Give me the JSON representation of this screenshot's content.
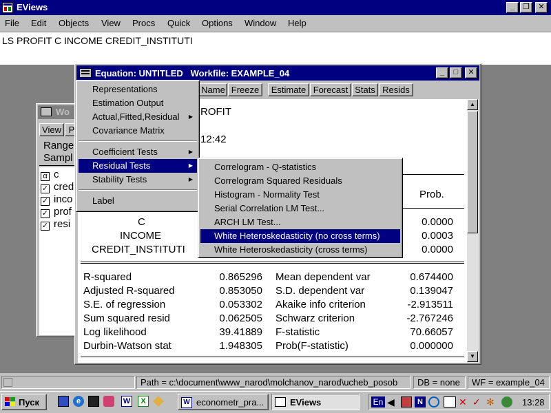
{
  "app": {
    "title": "EViews",
    "menu": [
      "File",
      "Edit",
      "Objects",
      "View",
      "Procs",
      "Quick",
      "Options",
      "Window",
      "Help"
    ],
    "command": "LS PROFIT  C INCOME CREDIT_INSTITUTI"
  },
  "back_window": {
    "title": "Wo",
    "toolbar": [
      "View",
      "P"
    ],
    "lines": [
      "Range",
      "Sampl"
    ],
    "items": [
      {
        "icon": "α",
        "label": "c"
      },
      {
        "icon": "✓",
        "label": "cred"
      },
      {
        "icon": "✓",
        "label": "inco"
      },
      {
        "icon": "✓",
        "label": "prof"
      },
      {
        "icon": "✓",
        "label": "resi"
      }
    ]
  },
  "eq_window": {
    "title": "Equation: UNTITLED   Workfile: EXAMPLE_04",
    "toolbar": [
      "Name",
      "Freeze",
      "Estimate",
      "Forecast",
      "Stats",
      "Resids"
    ],
    "partial_lines": [
      "ROFIT",
      "12:42"
    ],
    "prob_header": "Prob.",
    "coef_rows": [
      {
        "name": "C",
        "prob": "0.0000"
      },
      {
        "name": "INCOME",
        "prob": "0.0003"
      },
      {
        "name": "CREDIT_INSTITUTI",
        "prob": "0.0000"
      }
    ],
    "stats_left": [
      {
        "label": "R-squared",
        "value": "0.865296"
      },
      {
        "label": "Adjusted R-squared",
        "value": "0.853050"
      },
      {
        "label": "S.E. of regression",
        "value": "0.053302"
      },
      {
        "label": "Sum squared resid",
        "value": "0.062505"
      },
      {
        "label": "Log likelihood",
        "value": "39.41889"
      },
      {
        "label": "Durbin-Watson stat",
        "value": "1.948305"
      }
    ],
    "stats_right": [
      {
        "label": "Mean dependent var",
        "value": "0.674400"
      },
      {
        "label": "S.D. dependent var",
        "value": "0.139047"
      },
      {
        "label": "Akaike info criterion",
        "value": "-2.913511"
      },
      {
        "label": "Schwarz criterion",
        "value": "-2.767246"
      },
      {
        "label": "F-statistic",
        "value": "70.66057"
      },
      {
        "label": "Prob(F-statistic)",
        "value": "0.000000"
      }
    ]
  },
  "view_menu": {
    "items": [
      "Representations",
      "Estimation Output",
      "Actual,Fitted,Residual",
      "Covariance Matrix",
      "Coefficient Tests",
      "Residual Tests",
      "Stability Tests",
      "Label"
    ]
  },
  "residual_submenu": {
    "items": [
      "Correlogram - Q-statistics",
      "Correlogram Squared Residuals",
      "Histogram - Normality Test",
      "Serial Correlation LM Test...",
      "ARCH LM Test...",
      "White Heteroskedasticity (no cross terms)",
      "White Heteroskedasticity (cross terms)"
    ]
  },
  "status_bar": {
    "path": "Path = c:\\document\\www_narod\\molchanov_narod\\ucheb_posob",
    "db": "DB = none",
    "wf": "WF = example_04"
  },
  "taskbar": {
    "start": "Пуск",
    "tasks": [
      "econometr_pra...",
      "EViews"
    ],
    "lang": "En",
    "clock": "13:28"
  },
  "colors": {
    "titlebar": "#000080",
    "desktop": "#808080",
    "face": "#c0c0c0"
  }
}
